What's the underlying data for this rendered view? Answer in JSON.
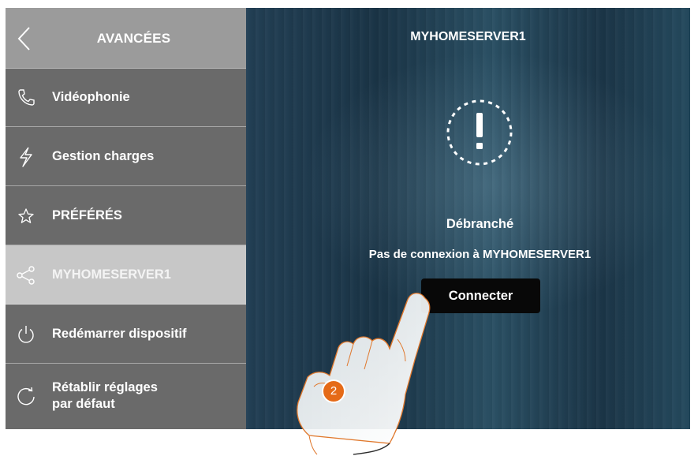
{
  "sidebar": {
    "title": "AVANCÉES",
    "back_icon": "chevron-left-icon",
    "items": [
      {
        "label": "Vidéophonie",
        "icon": "phone-icon"
      },
      {
        "label": "Gestion charges",
        "icon": "lightning-icon"
      },
      {
        "label": "PRÉFÉRÉS",
        "icon": "star-icon"
      },
      {
        "label": "MYHOMESERVER1",
        "icon": "share-icon",
        "active": true
      },
      {
        "label": "Redémarrer dispositif",
        "icon": "power-icon"
      },
      {
        "label_lines": [
          "Rétablir réglages",
          "par défaut"
        ],
        "icon": "refresh-icon"
      }
    ]
  },
  "main": {
    "title": "MYHOMESERVER1",
    "status_icon": "alert-icon",
    "status": "Débranché",
    "status_description": "Pas de connexion à MYHOMESERVER1",
    "connect_label": "Connecter"
  },
  "annotation": {
    "step_number": "2",
    "pointer": "hand-pointer-icon"
  },
  "colors": {
    "sidebar_bg": "#6a6a6a",
    "sidebar_header_bg": "#9b9b9b",
    "active_item_bg": "#c7c7c7",
    "main_bg": "#1c3a4e",
    "button_bg": "#080808",
    "badge": "#e56a17"
  }
}
